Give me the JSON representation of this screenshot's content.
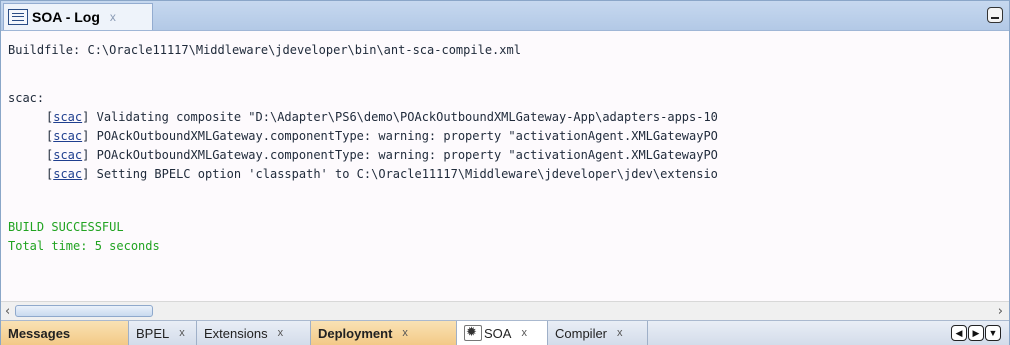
{
  "window": {
    "title": "SOA - Log",
    "close_glyph": "x",
    "icons": {
      "log": "log-document-icon",
      "minimize": "minimize-icon"
    }
  },
  "log": {
    "lines": [
      "Buildfile: C:\\Oracle11117\\Middleware\\jdeveloper\\bin\\ant-sca-compile.xml",
      "scac:",
      "Validating composite \"D:\\Adapter\\PS6\\demo\\POAckOutboundXMLGateway-App\\adapters-apps-10",
      "POAckOutboundXMLGateway.componentType: warning: property \"activationAgent.XMLGatewayPO",
      "POAckOutboundXMLGateway.componentType: warning: property \"activationAgent.XMLGatewayPO",
      "Setting BPELC option 'classpath' to C:\\Oracle11117\\Middleware\\jdeveloper\\jdev\\extensio",
      "BUILD SUCCESSFUL",
      "Total time: 5 seconds"
    ],
    "task_link": "scac",
    "colors": {
      "text": "#1f2a3a",
      "success": "#21a321",
      "link": "#1f3f8f"
    }
  },
  "tabs": [
    {
      "label": "Messages",
      "close": ""
    },
    {
      "label": "BPEL",
      "close": "x"
    },
    {
      "label": "Extensions",
      "close": "x"
    },
    {
      "label": "Deployment",
      "close": "x"
    },
    {
      "label": "SOA",
      "close": "x"
    },
    {
      "label": "Compiler",
      "close": "x"
    }
  ],
  "nav": {
    "prev": "◀",
    "next": "▶",
    "list": "▼"
  },
  "colors": {
    "highlight_tab": "#f3c987",
    "titlebar": "#b3c9e6"
  }
}
